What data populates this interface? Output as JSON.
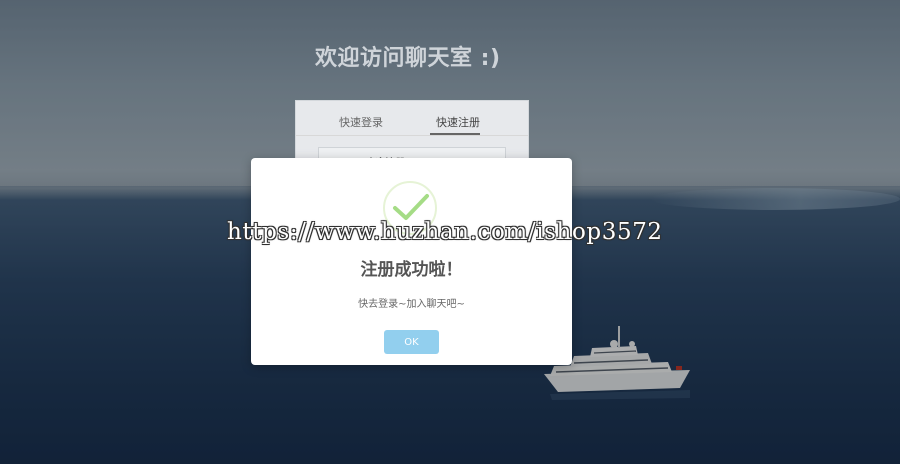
{
  "page": {
    "headline": "欢迎访问聊天室 :)"
  },
  "login_panel": {
    "tabs": [
      {
        "label": "快速登录"
      },
      {
        "label": "快速注册"
      }
    ],
    "welcome_text": "欢迎注册FastChat！"
  },
  "modal": {
    "icon": "checkmark-icon",
    "title": "注册成功啦！",
    "message": "快去登录~加入聊天吧~",
    "ok_label": "OK"
  },
  "watermark": {
    "text": "https://www.huzhan.com/ishop3572"
  },
  "colors": {
    "ok_button": "#92cfee",
    "check": "#a5dc86",
    "modal_bg": "#ffffff"
  }
}
